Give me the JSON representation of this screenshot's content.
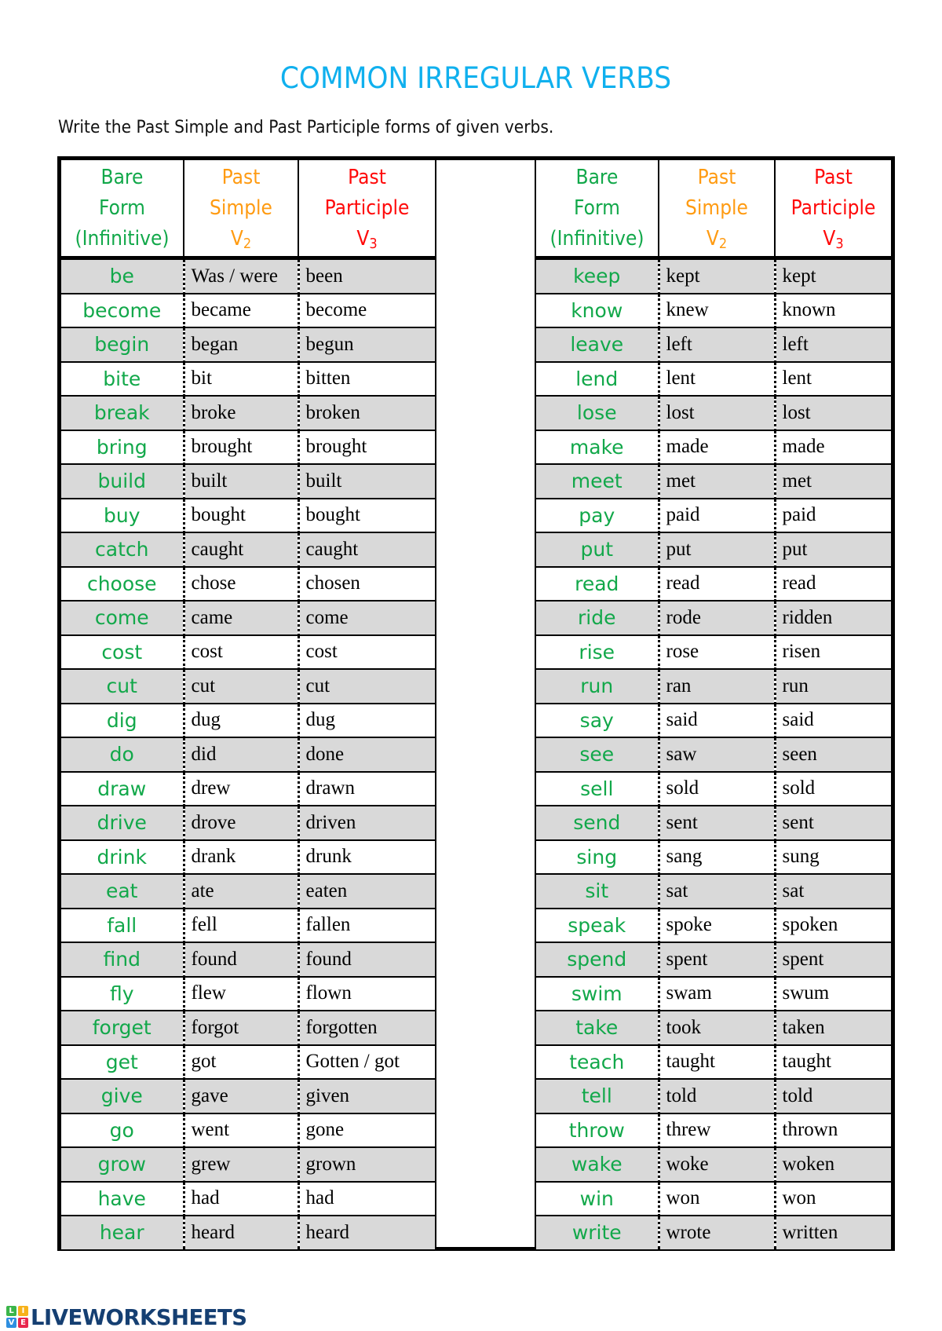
{
  "title": "COMMON IRREGULAR VERBS",
  "instruction": "Write the Past Simple and Past Participle forms of given verbs.",
  "colors": {
    "title": "#10b0ee",
    "bare_form": "#12a84a",
    "past_simple": "#ff9b12",
    "past_participle": "#ff0a0a",
    "shaded_row": "#d9d9d9",
    "logo_text": "#153f72"
  },
  "headers": {
    "bare": [
      "Bare",
      "Form",
      "(Infinitive)"
    ],
    "simple": [
      "Past",
      "Simple",
      "V",
      "2"
    ],
    "participle": [
      "Past",
      "Participle",
      "V",
      "3"
    ]
  },
  "left_table": [
    {
      "base": "be",
      "v2": "Was / were",
      "v3": "been"
    },
    {
      "base": "become",
      "v2": "became",
      "v3": "become"
    },
    {
      "base": "begin",
      "v2": "began",
      "v3": "begun"
    },
    {
      "base": "bite",
      "v2": "bit",
      "v3": "bitten"
    },
    {
      "base": "break",
      "v2": "broke",
      "v3": "broken"
    },
    {
      "base": "bring",
      "v2": "brought",
      "v3": "brought"
    },
    {
      "base": "build",
      "v2": "built",
      "v3": "built"
    },
    {
      "base": "buy",
      "v2": "bought",
      "v3": "bought"
    },
    {
      "base": "catch",
      "v2": "caught",
      "v3": "caught"
    },
    {
      "base": "choose",
      "v2": "chose",
      "v3": "chosen"
    },
    {
      "base": "come",
      "v2": "came",
      "v3": "come"
    },
    {
      "base": "cost",
      "v2": "cost",
      "v3": "cost"
    },
    {
      "base": "cut",
      "v2": "cut",
      "v3": "cut"
    },
    {
      "base": "dig",
      "v2": "dug",
      "v3": "dug"
    },
    {
      "base": "do",
      "v2": "did",
      "v3": "done"
    },
    {
      "base": "draw",
      "v2": "drew",
      "v3": "drawn"
    },
    {
      "base": "drive",
      "v2": "drove",
      "v3": "driven"
    },
    {
      "base": "drink",
      "v2": "drank",
      "v3": "drunk"
    },
    {
      "base": "eat",
      "v2": "ate",
      "v3": "eaten"
    },
    {
      "base": "fall",
      "v2": "fell",
      "v3": "fallen"
    },
    {
      "base": "find",
      "v2": "found",
      "v3": "found"
    },
    {
      "base": "fly",
      "v2": "flew",
      "v3": "flown"
    },
    {
      "base": "forget",
      "v2": "forgot",
      "v3": "forgotten"
    },
    {
      "base": "get",
      "v2": "got",
      "v3": "Gotten / got"
    },
    {
      "base": "give",
      "v2": "gave",
      "v3": "given"
    },
    {
      "base": "go",
      "v2": "went",
      "v3": "gone"
    },
    {
      "base": "grow",
      "v2": "grew",
      "v3": "grown"
    },
    {
      "base": "have",
      "v2": "had",
      "v3": "had"
    },
    {
      "base": "hear",
      "v2": "heard",
      "v3": "heard"
    }
  ],
  "right_table": [
    {
      "base": "keep",
      "v2": "kept",
      "v3": "kept"
    },
    {
      "base": "know",
      "v2": "knew",
      "v3": "known"
    },
    {
      "base": "leave",
      "v2": "left",
      "v3": "left"
    },
    {
      "base": "lend",
      "v2": "lent",
      "v3": "lent"
    },
    {
      "base": "lose",
      "v2": "lost",
      "v3": "lost"
    },
    {
      "base": "make",
      "v2": "made",
      "v3": "made"
    },
    {
      "base": "meet",
      "v2": "met",
      "v3": "met"
    },
    {
      "base": "pay",
      "v2": "paid",
      "v3": "paid"
    },
    {
      "base": "put",
      "v2": "put",
      "v3": "put"
    },
    {
      "base": "read",
      "v2": "read",
      "v3": "read"
    },
    {
      "base": "ride",
      "v2": "rode",
      "v3": "ridden"
    },
    {
      "base": "rise",
      "v2": "rose",
      "v3": "risen"
    },
    {
      "base": "run",
      "v2": "ran",
      "v3": "run"
    },
    {
      "base": "say",
      "v2": "said",
      "v3": "said"
    },
    {
      "base": "see",
      "v2": "saw",
      "v3": "seen"
    },
    {
      "base": "sell",
      "v2": "sold",
      "v3": "sold"
    },
    {
      "base": "send",
      "v2": "sent",
      "v3": "sent"
    },
    {
      "base": "sing",
      "v2": "sang",
      "v3": "sung"
    },
    {
      "base": "sit",
      "v2": "sat",
      "v3": "sat"
    },
    {
      "base": "speak",
      "v2": "spoke",
      "v3": "spoken"
    },
    {
      "base": "spend",
      "v2": "spent",
      "v3": "spent"
    },
    {
      "base": "swim",
      "v2": "swam",
      "v3": "swum"
    },
    {
      "base": "take",
      "v2": "took",
      "v3": "taken"
    },
    {
      "base": "teach",
      "v2": "taught",
      "v3": "taught"
    },
    {
      "base": "tell",
      "v2": "told",
      "v3": "told"
    },
    {
      "base": "throw",
      "v2": "threw",
      "v3": "thrown"
    },
    {
      "base": "wake",
      "v2": "woke",
      "v3": "woken"
    },
    {
      "base": "win",
      "v2": "won",
      "v3": "won"
    },
    {
      "base": "write",
      "v2": "wrote",
      "v3": "written"
    }
  ],
  "footer": {
    "logo_icon": "live-blocks-icon",
    "logo_blocks": [
      {
        "letter": "L",
        "color": "#3bb54a"
      },
      {
        "letter": "I",
        "color": "#f7b21b"
      },
      {
        "letter": "V",
        "color": "#2f8fe0"
      },
      {
        "letter": "E",
        "color": "#e8264d"
      }
    ],
    "logo_text": "LIVEWORKSHEETS"
  }
}
